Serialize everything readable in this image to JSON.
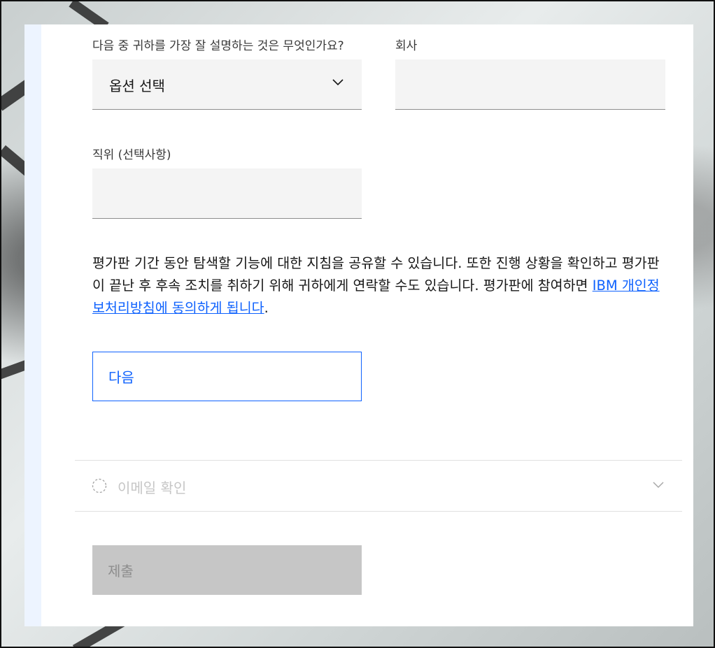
{
  "form": {
    "role_question_label": "다음 중 귀하를 가장 잘 설명하는 것은 무엇인가요?",
    "role_select_value": "옵션 선택",
    "company_label": "회사",
    "company_value": "",
    "title_label": "직위 (선택사항)",
    "title_value": "",
    "notice_text": "평가판 기간 동안 탐색할 기능에 대한 지침을 공유할 수 있습니다. 또한 진행 상황을 확인하고 평가판이 끝난 후 후속 조치를 취하기 위해 귀하에게 연락할 수도 있습니다. 평가판에 참여하면 ",
    "privacy_link": "IBM 개인정보처리방침에 동의하게 됩니다",
    "notice_end": ".",
    "next_button": "다음",
    "email_step_label": "이메일 확인",
    "submit_button": "제출"
  },
  "icons": {
    "select": "chevron-down-icon",
    "step_status": "dashed-circle-icon",
    "step_toggle": "chevron-down-icon"
  },
  "colors": {
    "accent": "#0f62fe",
    "field_bg": "#f4f4f4",
    "disabled_bg": "#c6c6c6",
    "disabled_text": "#8d8d8d"
  }
}
